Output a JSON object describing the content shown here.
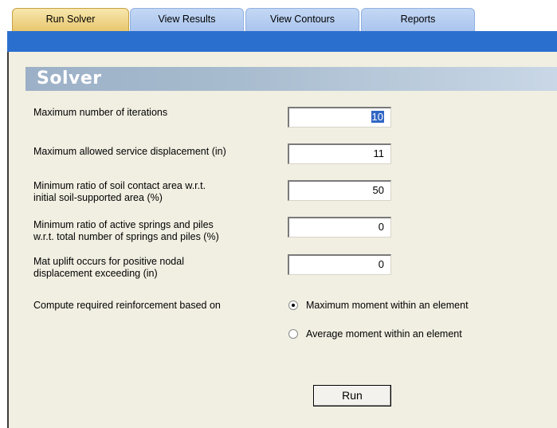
{
  "tabs": [
    {
      "label": "Run Solver",
      "active": true
    },
    {
      "label": "View Results",
      "active": false
    },
    {
      "label": "View Contours",
      "active": false
    },
    {
      "label": "Reports",
      "active": false
    }
  ],
  "solver": {
    "title": "Solver",
    "fields": [
      {
        "label_line1": "Maximum number of iterations",
        "label_line2": "",
        "value": "10",
        "selected": true
      },
      {
        "label_line1": "Maximum allowed service displacement (in)",
        "label_line2": "",
        "value": "11",
        "selected": false
      },
      {
        "label_line1": "Minimum ratio of soil contact area w.r.t.",
        "label_line2": "initial soil-supported area (%)",
        "value": "50",
        "selected": false
      },
      {
        "label_line1": "Minimum ratio of active springs and piles",
        "label_line2": "w.r.t. total number of springs and piles (%)",
        "value": "0",
        "selected": false
      },
      {
        "label_line1": "Mat uplift occurs for positive nodal",
        "label_line2": "displacement exceeding (in)",
        "value": "0",
        "selected": false
      }
    ],
    "reinforcement": {
      "label": "Compute required reinforcement based on",
      "options": [
        {
          "label": "Maximum moment within an element",
          "checked": true
        },
        {
          "label": "Average moment within an element",
          "checked": false
        }
      ]
    },
    "run_label": "Run"
  },
  "colors": {
    "band": "#2b6fce",
    "panel_bg": "#f1efe2",
    "tab_active": "#e8c56c",
    "tab_inactive": "#a9c4ee",
    "selection": "#3166c5"
  }
}
